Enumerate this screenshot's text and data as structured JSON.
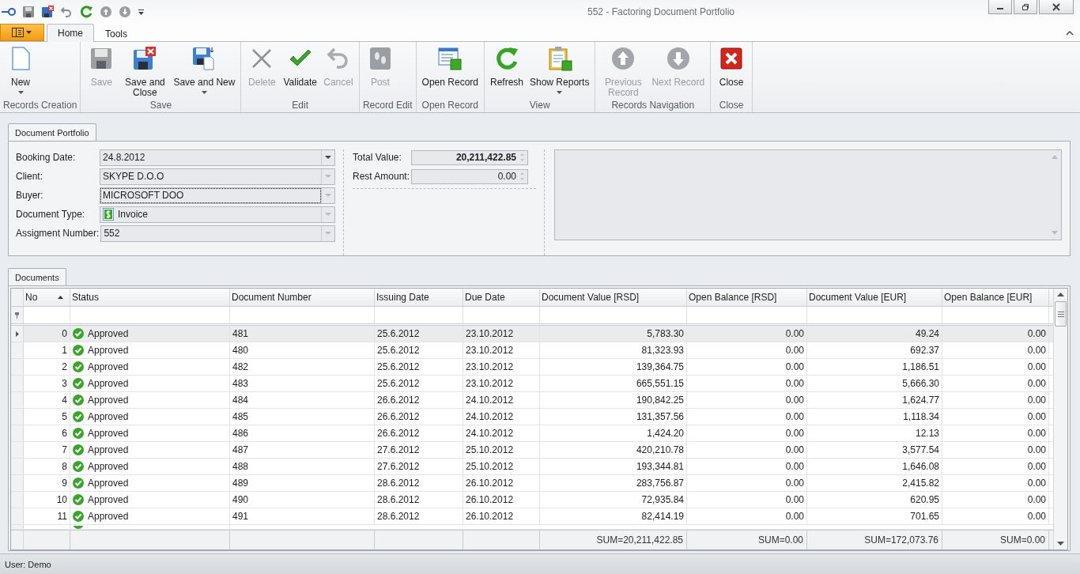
{
  "window": {
    "title": "552 - Factoring Document Portfolio"
  },
  "ribbon_tabs": [
    {
      "label": "Home",
      "selected": true
    },
    {
      "label": "Tools",
      "selected": false
    }
  ],
  "ribbon_groups": [
    {
      "label": "Records Creation",
      "buttons": [
        {
          "label": "New",
          "kind": "new",
          "disabled": false,
          "dropdown": true
        }
      ]
    },
    {
      "label": "Save",
      "buttons": [
        {
          "label": "Save",
          "kind": "save",
          "disabled": true,
          "dropdown": false
        },
        {
          "label": "Save and Close",
          "kind": "save-close",
          "disabled": false,
          "dropdown": false
        },
        {
          "label": "Save and New",
          "kind": "save-new",
          "disabled": false,
          "dropdown": true
        }
      ]
    },
    {
      "label": "Edit",
      "buttons": [
        {
          "label": "Delete",
          "kind": "delete",
          "disabled": true,
          "dropdown": false
        },
        {
          "label": "Validate",
          "kind": "validate",
          "disabled": false,
          "dropdown": false
        },
        {
          "label": "Cancel",
          "kind": "cancel",
          "disabled": true,
          "dropdown": false
        }
      ]
    },
    {
      "label": "Record Edit",
      "buttons": [
        {
          "label": "Post",
          "kind": "post",
          "disabled": true,
          "dropdown": false
        }
      ]
    },
    {
      "label": "Open Record",
      "buttons": [
        {
          "label": "Open Record",
          "kind": "open",
          "disabled": false,
          "dropdown": false
        }
      ]
    },
    {
      "label": "View",
      "buttons": [
        {
          "label": "Refresh",
          "kind": "refresh",
          "disabled": false,
          "dropdown": false
        },
        {
          "label": "Show Reports",
          "kind": "reports",
          "disabled": false,
          "dropdown": true
        }
      ]
    },
    {
      "label": "Records Navigation",
      "buttons": [
        {
          "label": "Previous Record",
          "kind": "up",
          "disabled": true,
          "dropdown": false
        },
        {
          "label": "Next Record",
          "kind": "down",
          "disabled": true,
          "dropdown": false
        }
      ]
    },
    {
      "label": "Close",
      "buttons": [
        {
          "label": "Close",
          "kind": "close",
          "disabled": false,
          "dropdown": false
        }
      ]
    }
  ],
  "portfolio_tab": "Document Portfolio",
  "form_fields": [
    {
      "label": "Booking Date:",
      "value": "24.8.2012",
      "disabled": false,
      "focused": false,
      "kind": "text"
    },
    {
      "label": "Client:",
      "value": "SKYPE D.O.O",
      "disabled": true,
      "focused": false,
      "kind": "text"
    },
    {
      "label": "Buyer:",
      "value": "MICROSOFT DOO",
      "disabled": true,
      "focused": true,
      "kind": "text"
    },
    {
      "label": "Document Type:",
      "value": "Invoice",
      "disabled": true,
      "focused": false,
      "kind": "invoice"
    },
    {
      "label": "Assigment Number:",
      "value": "552",
      "disabled": true,
      "focused": false,
      "kind": "text"
    }
  ],
  "amount_fields": [
    {
      "label": "Total Value:",
      "value": "20,211,422.85",
      "bold": true
    },
    {
      "label": "Rest Amount:",
      "value": "0.00",
      "bold": false
    }
  ],
  "documents_tab": "Documents",
  "table": {
    "columns": [
      "No",
      "Status",
      "Document Number",
      "Issuing Date",
      "Due Date",
      "Document Value [RSD]",
      "Open Balance [RSD]",
      "Document Value [EUR]",
      "Open Balance [EUR]"
    ],
    "rows": [
      {
        "selected": true,
        "cells": [
          "0",
          "Approved",
          "481",
          "25.6.2012",
          "23.10.2012",
          "5,783.30",
          "0.00",
          "49.24",
          "0.00"
        ]
      },
      {
        "selected": false,
        "cells": [
          "1",
          "Approved",
          "480",
          "25.6.2012",
          "23.10.2012",
          "81,323.93",
          "0.00",
          "692.37",
          "0.00"
        ]
      },
      {
        "selected": false,
        "cells": [
          "2",
          "Approved",
          "482",
          "25.6.2012",
          "23.10.2012",
          "139,364.75",
          "0.00",
          "1,186.51",
          "0.00"
        ]
      },
      {
        "selected": false,
        "cells": [
          "3",
          "Approved",
          "483",
          "25.6.2012",
          "23.10.2012",
          "665,551.15",
          "0.00",
          "5,666.30",
          "0.00"
        ]
      },
      {
        "selected": false,
        "cells": [
          "4",
          "Approved",
          "484",
          "26.6.2012",
          "24.10.2012",
          "190,842.25",
          "0.00",
          "1,624.77",
          "0.00"
        ]
      },
      {
        "selected": false,
        "cells": [
          "5",
          "Approved",
          "485",
          "26.6.2012",
          "24.10.2012",
          "131,357.56",
          "0.00",
          "1,118.34",
          "0.00"
        ]
      },
      {
        "selected": false,
        "cells": [
          "6",
          "Approved",
          "486",
          "26.6.2012",
          "24.10.2012",
          "1,424.20",
          "0.00",
          "12.13",
          "0.00"
        ]
      },
      {
        "selected": false,
        "cells": [
          "7",
          "Approved",
          "487",
          "27.6.2012",
          "25.10.2012",
          "420,210.78",
          "0.00",
          "3,577.54",
          "0.00"
        ]
      },
      {
        "selected": false,
        "cells": [
          "8",
          "Approved",
          "488",
          "27.6.2012",
          "25.10.2012",
          "193,344.81",
          "0.00",
          "1,646.08",
          "0.00"
        ]
      },
      {
        "selected": false,
        "cells": [
          "9",
          "Approved",
          "489",
          "28.6.2012",
          "26.10.2012",
          "283,756.87",
          "0.00",
          "2,415.82",
          "0.00"
        ]
      },
      {
        "selected": false,
        "cells": [
          "10",
          "Approved",
          "490",
          "28.6.2012",
          "26.10.2012",
          "72,935.84",
          "0.00",
          "620.95",
          "0.00"
        ]
      },
      {
        "selected": false,
        "cells": [
          "11",
          "Approved",
          "491",
          "28.6.2012",
          "26.10.2012",
          "82,414.19",
          "0.00",
          "701.65",
          "0.00"
        ]
      }
    ],
    "totals": [
      "SUM=20,211,422.85",
      "SUM=0.00",
      "SUM=172,073.76",
      "SUM=0.00"
    ]
  },
  "status_bar": "User: Demo"
}
